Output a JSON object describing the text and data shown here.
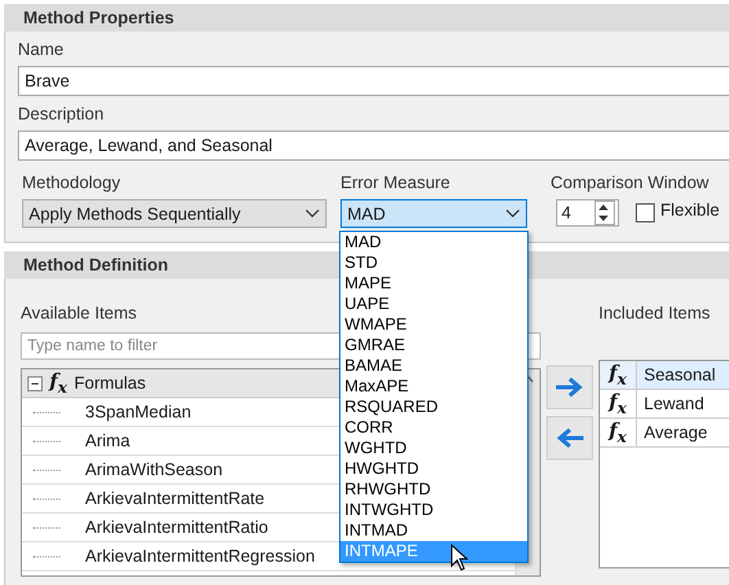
{
  "properties": {
    "title": "Method Properties",
    "name": {
      "label": "Name",
      "value": "Brave"
    },
    "description": {
      "label": "Description",
      "value": "Average, Lewand, and Seasonal"
    },
    "methodology": {
      "label": "Methodology",
      "value": "Apply Methods Sequentially"
    },
    "error_measure": {
      "label": "Error Measure",
      "value": "MAD",
      "expanded": true,
      "options": [
        {
          "label": "MAD",
          "highlighted": false
        },
        {
          "label": "STD",
          "highlighted": false
        },
        {
          "label": "MAPE",
          "highlighted": false
        },
        {
          "label": "UAPE",
          "highlighted": false
        },
        {
          "label": "WMAPE",
          "highlighted": false
        },
        {
          "label": "GMRAE",
          "highlighted": false
        },
        {
          "label": "BAMAE",
          "highlighted": false
        },
        {
          "label": "MaxAPE",
          "highlighted": false
        },
        {
          "label": "RSQUARED",
          "highlighted": false
        },
        {
          "label": "CORR",
          "highlighted": false
        },
        {
          "label": "WGHTD",
          "highlighted": false
        },
        {
          "label": "HWGHTD",
          "highlighted": false
        },
        {
          "label": "RHWGHTD",
          "highlighted": false
        },
        {
          "label": "INTWGHTD",
          "highlighted": false
        },
        {
          "label": "INTMAD",
          "highlighted": false
        },
        {
          "label": "INTMAPE",
          "highlighted": true
        }
      ]
    },
    "comparison_window": {
      "label": "Comparison Window",
      "value": "4"
    },
    "flexible": {
      "label": "Flexible",
      "checked": false
    }
  },
  "definition": {
    "title": "Method Definition",
    "available": {
      "label": "Available Items",
      "filter_placeholder": "Type name to filter",
      "tree": {
        "label": "Formulas",
        "icon": "f$_{x}$",
        "expanded": true,
        "children": [
          {
            "label": "3SpanMedian"
          },
          {
            "label": "Arima"
          },
          {
            "label": "ArimaWithSeason"
          },
          {
            "label": "ArkievaIntermittentRate"
          },
          {
            "label": "ArkievaIntermittentRatio"
          },
          {
            "label": "ArkievaIntermittentRegression"
          }
        ]
      }
    },
    "included": {
      "label": "Included Items",
      "rows": [
        {
          "icon": "f$_{x}$",
          "label": "Seasonal",
          "selected": true
        },
        {
          "icon": "f$_{x}$",
          "label": "Lewand",
          "selected": false
        },
        {
          "icon": "f$_{x}$",
          "label": "Average",
          "selected": false
        }
      ]
    }
  }
}
